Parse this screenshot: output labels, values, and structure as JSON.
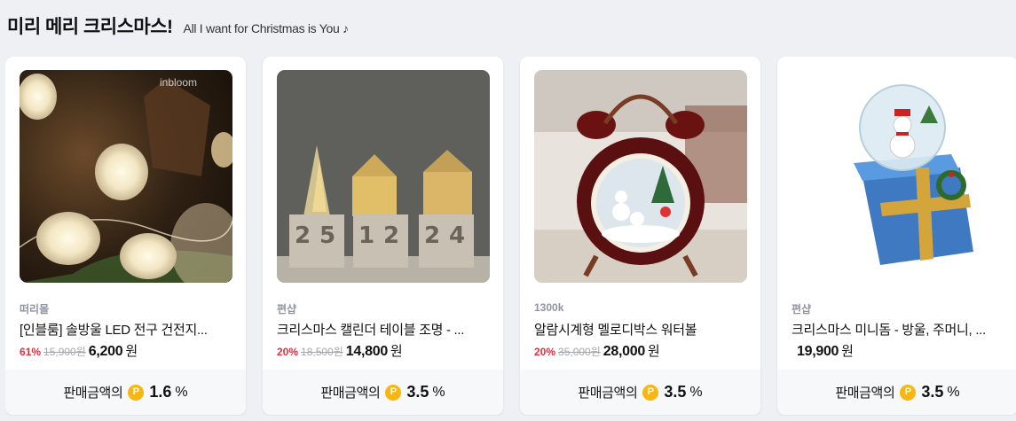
{
  "header": {
    "title": "미리 메리 크리스마스!",
    "subtitle": "All I want for Christmas is You ♪"
  },
  "footer_label": "판매금액의",
  "point_symbol": "P",
  "point_color": "#f7b614",
  "discount_color": "#e33041",
  "products": [
    {
      "seller": "떠리몰",
      "name": "[인블룸] 솔방울 LED 전구 건전지...",
      "discount": "61%",
      "original_price": "15,900원",
      "price": "6,200",
      "currency": "원",
      "reward_rate": "1.6",
      "reward_unit": "%",
      "image": "pinecone-led-lights",
      "watermark": "inbloom"
    },
    {
      "seller": "편샵",
      "name": "크리스마스 캘린더 테이블 조명 - ...",
      "discount": "20%",
      "original_price": "18,500원",
      "price": "14,800",
      "currency": "원",
      "reward_rate": "3.5",
      "reward_unit": "%",
      "image": "christmas-calendar-lamp"
    },
    {
      "seller": "1300k",
      "name": "알람시계형 멜로디박스 워터볼",
      "discount": "20%",
      "original_price": "35,000원",
      "price": "28,000",
      "currency": "원",
      "reward_rate": "3.5",
      "reward_unit": "%",
      "image": "alarm-clock-waterball"
    },
    {
      "seller": "편샵",
      "name": "크리스마스 미니돔 - 방울, 주머니, ...",
      "discount": "",
      "original_price": "",
      "price": "19,900",
      "currency": "원",
      "reward_rate": "3.5",
      "reward_unit": "%",
      "image": "snowman-mini-dome"
    }
  ]
}
